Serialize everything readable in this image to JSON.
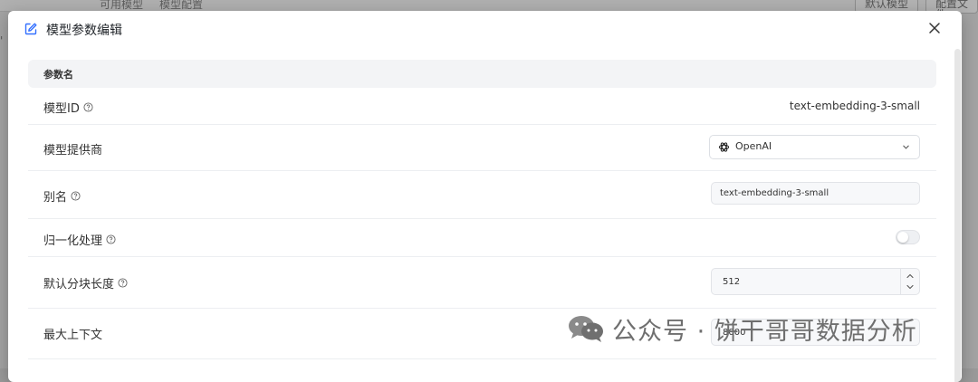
{
  "background": {
    "tabs": [
      "可用模型",
      "模型配置"
    ],
    "buttons": [
      "默认模型",
      "配置文件"
    ]
  },
  "modal": {
    "title": "模型参数编辑",
    "table_header": "参数名",
    "rows": {
      "model_id": {
        "label": "模型ID",
        "value": "text-embedding-3-small"
      },
      "provider": {
        "label": "模型提供商",
        "selected": "OpenAI"
      },
      "alias": {
        "label": "别名",
        "value": "text-embedding-3-small"
      },
      "normalize": {
        "label": "归一化处理",
        "enabled": false
      },
      "chunk_length": {
        "label": "默认分块长度",
        "value": "512"
      },
      "max_context": {
        "label": "最大上下文",
        "value": "8000"
      }
    }
  },
  "watermark": {
    "text": "公众号 · 饼干哥哥数据分析"
  },
  "colors": {
    "accent": "#3370ff",
    "header_bg": "#f3f4f6",
    "input_bg": "#f7f8fa"
  }
}
